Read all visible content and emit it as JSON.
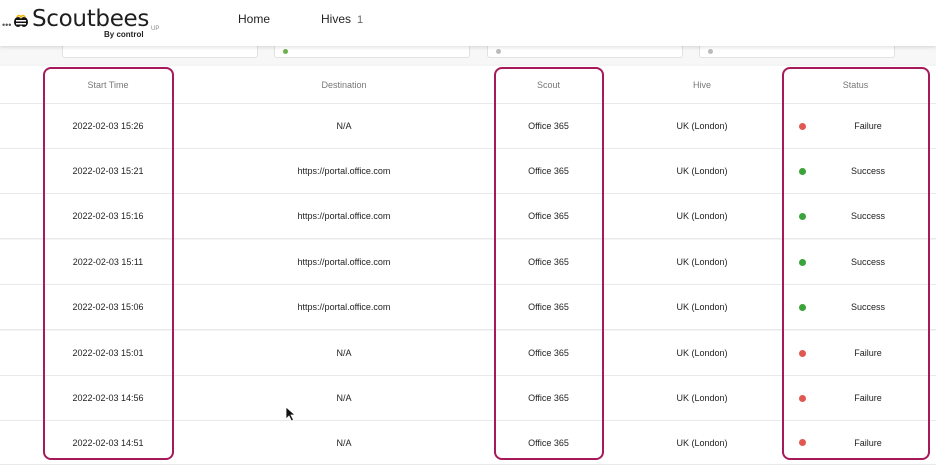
{
  "brand": {
    "dots": "•••",
    "name": "Scoutbees",
    "byline": "By control",
    "tag": "UP"
  },
  "nav": {
    "home": "Home",
    "hives": "Hives",
    "hives_count": "1"
  },
  "table": {
    "headers": {
      "start": "Start Time",
      "destination": "Destination",
      "scout": "Scout",
      "hive": "Hive",
      "status": "Status"
    },
    "rows": [
      {
        "start": "2022-02-03 15:26",
        "destination": "N/A",
        "scout": "Office 365",
        "hive": "UK (London)",
        "status": "Failure"
      },
      {
        "start": "2022-02-03 15:21",
        "destination": "https://portal.office.com",
        "scout": "Office 365",
        "hive": "UK (London)",
        "status": "Success"
      },
      {
        "start": "2022-02-03 15:16",
        "destination": "https://portal.office.com",
        "scout": "Office 365",
        "hive": "UK (London)",
        "status": "Success"
      },
      {
        "start": "2022-02-03 15:11",
        "destination": "https://portal.office.com",
        "scout": "Office 365",
        "hive": "UK (London)",
        "status": "Success"
      },
      {
        "start": "2022-02-03 15:06",
        "destination": "https://portal.office.com",
        "scout": "Office 365",
        "hive": "UK (London)",
        "status": "Success"
      },
      {
        "start": "2022-02-03 15:01",
        "destination": "N/A",
        "scout": "Office 365",
        "hive": "UK (London)",
        "status": "Failure"
      },
      {
        "start": "2022-02-03 14:56",
        "destination": "N/A",
        "scout": "Office 365",
        "hive": "UK (London)",
        "status": "Failure"
      },
      {
        "start": "2022-02-03 14:51",
        "destination": "N/A",
        "scout": "Office 365",
        "hive": "UK (London)",
        "status": "Failure"
      }
    ]
  },
  "colors": {
    "success": "#3aa33a",
    "failure": "#e0584f",
    "highlight": "#a6195a"
  }
}
